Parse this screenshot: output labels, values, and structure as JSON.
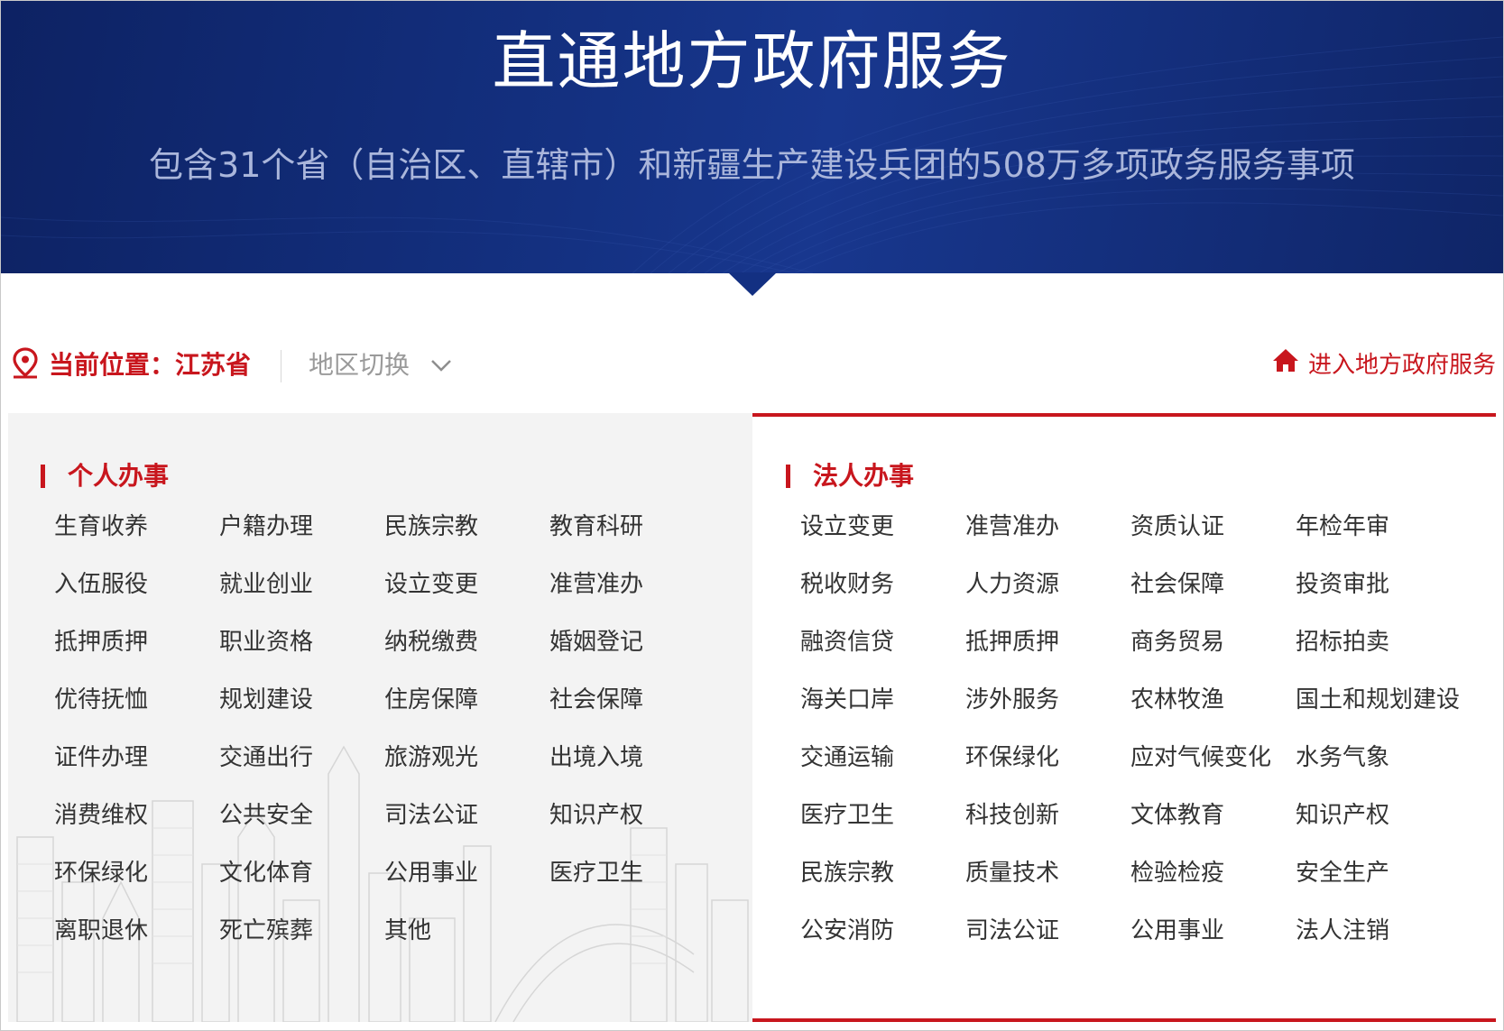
{
  "banner": {
    "title": "直通地方政府服务",
    "subtitle": "包含31个省（自治区、直辖市）和新疆生产建设兵团的508万多项政务服务事项"
  },
  "location": {
    "current_label": "当前位置：江苏省",
    "switch_label": "地区切换",
    "enter_label": "进入地方政府服务"
  },
  "personal": {
    "title": "个人办事",
    "items": [
      "生育收养",
      "户籍办理",
      "民族宗教",
      "教育科研",
      "入伍服役",
      "就业创业",
      "设立变更",
      "准营准办",
      "抵押质押",
      "职业资格",
      "纳税缴费",
      "婚姻登记",
      "优待抚恤",
      "规划建设",
      "住房保障",
      "社会保障",
      "证件办理",
      "交通出行",
      "旅游观光",
      "出境入境",
      "消费维权",
      "公共安全",
      "司法公证",
      "知识产权",
      "环保绿化",
      "文化体育",
      "公用事业",
      "医疗卫生",
      "离职退休",
      "死亡殡葬",
      "其他"
    ]
  },
  "legal": {
    "title": "法人办事",
    "items": [
      "设立变更",
      "准营准办",
      "资质认证",
      "年检年审",
      "税收财务",
      "人力资源",
      "社会保障",
      "投资审批",
      "融资信贷",
      "抵押质押",
      "商务贸易",
      "招标拍卖",
      "海关口岸",
      "涉外服务",
      "农林牧渔",
      "国土和规划建设",
      "交通运输",
      "环保绿化",
      "应对气候变化",
      "水务气象",
      "医疗卫生",
      "科技创新",
      "文体教育",
      "知识产权",
      "民族宗教",
      "质量技术",
      "检验检疫",
      "安全生产",
      "公安消防",
      "司法公证",
      "公用事业",
      "法人注销"
    ]
  },
  "colors": {
    "accent_red": "#c8161d",
    "banner_blue": "#143182",
    "panel_gray": "#f3f3f3",
    "item_text": "#333333"
  }
}
